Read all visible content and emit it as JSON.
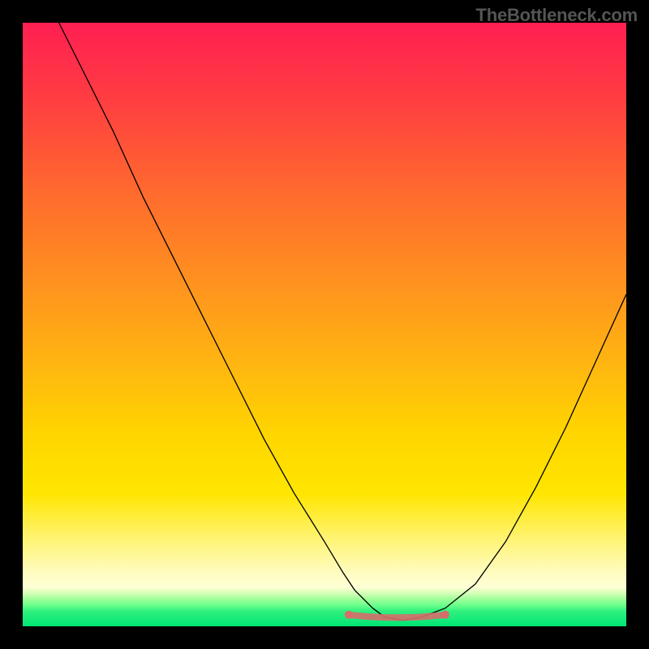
{
  "watermark": "TheBottleneck.com",
  "chart_data": {
    "type": "line",
    "title": "",
    "xlabel": "",
    "ylabel": "",
    "xlim": [
      0,
      100
    ],
    "ylim": [
      0,
      100
    ],
    "note": "No axes, ticks, legend, or data labels are rendered in the figure; x/y values below are in percent of the inner plot box (0–100) with y=0 at the bottom. Values estimated visually from the image.",
    "series": [
      {
        "name": "bottleneck-curve",
        "x": [
          6,
          10,
          15,
          20,
          25,
          30,
          35,
          40,
          45,
          50,
          53,
          55,
          58,
          60,
          63,
          66,
          70,
          75,
          80,
          85,
          90,
          95,
          100
        ],
        "y": [
          100,
          92,
          82,
          71,
          61,
          51,
          41,
          31,
          22,
          14,
          9,
          6,
          3,
          1.5,
          1,
          1.5,
          3,
          7,
          14,
          23,
          33,
          44,
          55
        ]
      }
    ],
    "optimal_zone": {
      "name": "optimal-balance-band",
      "x_start": 54,
      "x_end": 70,
      "y": 1.5
    },
    "gradient_stops": [
      {
        "pos": 0,
        "color": "#ff1f52"
      },
      {
        "pos": 12,
        "color": "#ff3b42"
      },
      {
        "pos": 28,
        "color": "#ff6a2e"
      },
      {
        "pos": 42,
        "color": "#ff8f20"
      },
      {
        "pos": 56,
        "color": "#ffb411"
      },
      {
        "pos": 68,
        "color": "#ffd500"
      },
      {
        "pos": 78,
        "color": "#ffe600"
      },
      {
        "pos": 86,
        "color": "#fff47a"
      },
      {
        "pos": 91,
        "color": "#fffcbe"
      },
      {
        "pos": 94.5,
        "color": "#d6ffb8"
      },
      {
        "pos": 97.5,
        "color": "#30f07d"
      },
      {
        "pos": 100,
        "color": "#00e676"
      }
    ]
  }
}
